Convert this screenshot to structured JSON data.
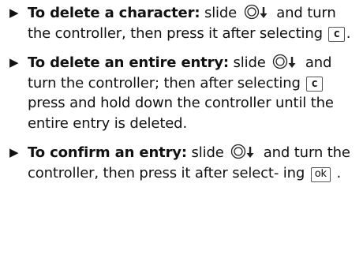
{
  "instructions": [
    {
      "lead": "To delete a character:",
      "text_a": " slide ",
      "text_b": " and turn the controller, then press it after selecting ",
      "key_label": "c",
      "text_c": "."
    },
    {
      "lead": "To delete an entire entry:",
      "text_a": " slide ",
      "text_b": " and turn the controller; then after selecting ",
      "key_label": "c",
      "text_c": " press and hold down the controller until the entire entry is deleted."
    },
    {
      "lead": "To confirm an entry:",
      "text_a": " slide ",
      "text_b": " and turn the controller, then press it after select- ing ",
      "key_label": "ok",
      "text_c": " ."
    }
  ],
  "icons": {
    "bullet": "arrow-bullet-icon",
    "controller": "controller-slide-down-icon"
  }
}
